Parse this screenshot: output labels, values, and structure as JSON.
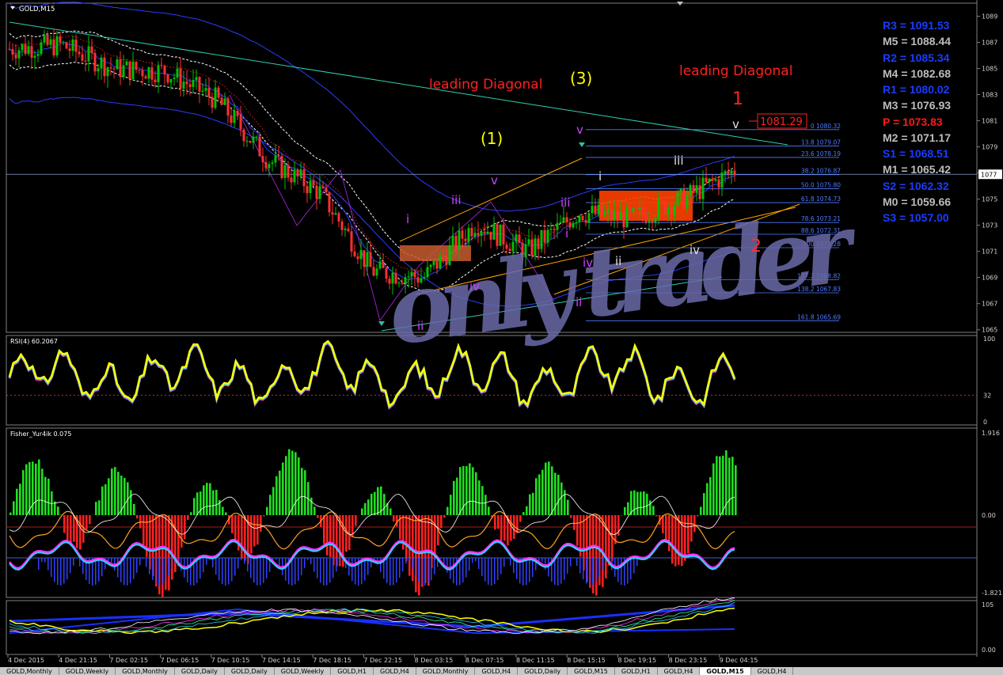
{
  "symbol": "GOLD,M15",
  "colors": {
    "bg": "#000000",
    "bull": "#00c000",
    "bear": "#ff3030",
    "grid": "#4060a0",
    "fib": "#4f7bff",
    "red_label": "#ff2020",
    "yellow_label": "#ffff00",
    "magenta_label": "#d040ff",
    "pivot_blue": "#1a3cff",
    "pivot_gray": "#bcbcbc",
    "pivot_red": "#ff1a1a",
    "watermark": "#6a6aa8"
  },
  "price_axis": [
    "1089",
    "1087",
    "1085",
    "1083",
    "1081",
    "1079",
    "1077",
    "1075",
    "1073",
    "1071",
    "1069",
    "1067",
    "1065"
  ],
  "current_price": "1077",
  "pivots": [
    {
      "label": "R3 = 1091.53",
      "color": "#1a3cff"
    },
    {
      "label": "M5 = 1088.44",
      "color": "#bcbcbc"
    },
    {
      "label": "R2 = 1085.34",
      "color": "#1a3cff"
    },
    {
      "label": "M4 = 1082.68",
      "color": "#bcbcbc"
    },
    {
      "label": "R1 = 1080.02",
      "color": "#1a3cff"
    },
    {
      "label": "M3 = 1076.93",
      "color": "#bcbcbc"
    },
    {
      "label": "P   = 1073.83",
      "color": "#ff1a1a"
    },
    {
      "label": "M2 = 1071.17",
      "color": "#bcbcbc"
    },
    {
      "label": "S1 = 1068.51",
      "color": "#1a3cff"
    },
    {
      "label": "M1 = 1065.42",
      "color": "#bcbcbc"
    },
    {
      "label": "S2 = 1062.32",
      "color": "#1a3cff"
    },
    {
      "label": "M0 = 1059.66",
      "color": "#bcbcbc"
    },
    {
      "label": "S3 = 1057.00",
      "color": "#1a3cff"
    }
  ],
  "fib_levels": [
    {
      "pct": "0",
      "price": 1080.32,
      "label": "0 1080.32"
    },
    {
      "pct": "13.8",
      "price": 1079.07,
      "label": "13.8 1079.07"
    },
    {
      "pct": "23.6",
      "price": 1078.19,
      "label": "23.6 1078.19"
    },
    {
      "pct": "38.2",
      "price": 1076.87,
      "label": "38.2 1076.87"
    },
    {
      "pct": "50.0",
      "price": 1075.8,
      "label": "50.0 1075.80"
    },
    {
      "pct": "61.8",
      "price": 1074.73,
      "label": "61.8 1074.73"
    },
    {
      "pct": "78.6",
      "price": 1073.21,
      "label": "78.6 1073.21"
    },
    {
      "pct": "88.6",
      "price": 1072.31,
      "label": "88.6 1072.31"
    },
    {
      "pct": "100",
      "price": 1071.28,
      "label": "100 1071.28"
    },
    {
      "pct": "127.2",
      "price": 1068.82,
      "label": "127.2 1068.82"
    },
    {
      "pct": "138.2",
      "price": 1067.83,
      "label": "138.2 1067.83"
    },
    {
      "pct": "161.8",
      "price": 1065.69,
      "label": "161.8 1065.69"
    }
  ],
  "annotations": {
    "leading_diagonal_1": "leading Diagonal",
    "leading_diagonal_2": "leading Diagonal",
    "wave_3": "(3)",
    "wave_1": "(1)",
    "wave_big_1": "1",
    "wave_big_2": "2",
    "price_box": "1081.29",
    "watermark": "only trader"
  },
  "wave_labels": [
    "i",
    "ii",
    "iii",
    "iv",
    "v",
    "i",
    "ii",
    "iii",
    "iv",
    "v",
    "i",
    "ii",
    "iii",
    "iv",
    "v"
  ],
  "rsi": {
    "title": "RSI(4) 60.2067",
    "levels": [
      "100",
      "32",
      "0"
    ]
  },
  "fisher": {
    "title": "Fisher_Yur4ik 0.075",
    "levels": [
      "1.916",
      "0.00",
      "-1.821"
    ]
  },
  "bottom_ind": {
    "levels": [
      "105",
      "0.00"
    ]
  },
  "time_axis": [
    "4 Dec 2015",
    "4 Dec 21:15",
    "7 Dec 02:15",
    "7 Dec 06:15",
    "7 Dec 10:15",
    "7 Dec 14:15",
    "7 Dec 18:15",
    "7 Dec 22:15",
    "8 Dec 03:15",
    "8 Dec 07:15",
    "8 Dec 11:15",
    "8 Dec 15:15",
    "8 Dec 19:15",
    "8 Dec 23:15",
    "9 Dec 04:15"
  ],
  "tabs": [
    "GOLD,Monthly",
    "GOLD,Weekly",
    "GOLD,Monthly",
    "GOLD,Daily",
    "GOLD,Daily",
    "GOLD,Weekly",
    "GOLD,H1",
    "GOLD,H4",
    "GOLD,Monthly",
    "GOLD,H4",
    "GOLD,Daily",
    "GOLD,M15",
    "GOLD,H1",
    "GOLD,H4",
    "GOLD,M15",
    "GOLD,H4"
  ],
  "active_tab": 14,
  "chart_data": {
    "type": "line",
    "title": "GOLD,M15",
    "xlabel": "",
    "ylabel": "",
    "x": [
      "4 Dec 2015",
      "4 Dec 21:15",
      "7 Dec 02:15",
      "7 Dec 06:15",
      "7 Dec 10:15",
      "7 Dec 14:15",
      "7 Dec 18:15",
      "7 Dec 22:15",
      "8 Dec 03:15",
      "8 Dec 07:15",
      "8 Dec 11:15",
      "8 Dec 15:15",
      "8 Dec 19:15",
      "8 Dec 23:15",
      "9 Dec 04:15"
    ],
    "series": [
      {
        "values": [
          1086.5,
          1086.8,
          1085.0,
          1084.8,
          1082.6,
          1078.0,
          1075.5,
          1069.5,
          1069.0,
          1073.2,
          1071.0,
          1074.0,
          1073.5,
          1075.0,
          1077.2
        ]
      }
    ],
    "ylim": [
      1064.8,
      1090.0
    ]
  }
}
